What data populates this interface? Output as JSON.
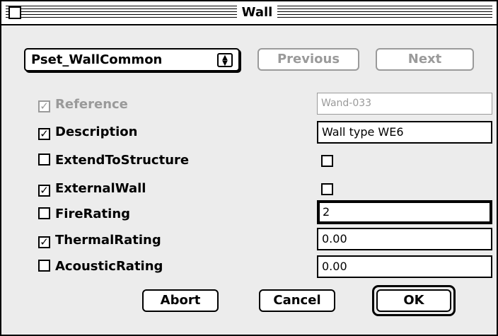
{
  "window": {
    "title": "Wall"
  },
  "pset": {
    "selected": "Pset_WallCommon",
    "arrows": "▲\n▼"
  },
  "nav": {
    "previous": "Previous",
    "next": "Next"
  },
  "properties": [
    {
      "label": "Reference",
      "checked": true,
      "enabled": false,
      "value_type": "text",
      "value": "Wand-033"
    },
    {
      "label": "Description",
      "checked": true,
      "enabled": true,
      "value_type": "text",
      "value": "Wall type WE6"
    },
    {
      "label": "ExtendToStructure",
      "checked": false,
      "enabled": true,
      "value_type": "bool",
      "value": false
    },
    {
      "label": "ExternalWall",
      "checked": true,
      "enabled": true,
      "value_type": "bool",
      "value": false
    },
    {
      "label": "FireRating",
      "checked": false,
      "enabled": true,
      "value_type": "text",
      "value": "2"
    },
    {
      "label": "ThermalRating",
      "checked": true,
      "enabled": true,
      "value_type": "text",
      "value": "0.00"
    },
    {
      "label": "AcousticRating",
      "checked": false,
      "enabled": true,
      "value_type": "text",
      "value": "0.00"
    }
  ],
  "buttons": {
    "abort": "Abort",
    "cancel": "Cancel",
    "ok": "OK"
  },
  "check_mark": "✓"
}
